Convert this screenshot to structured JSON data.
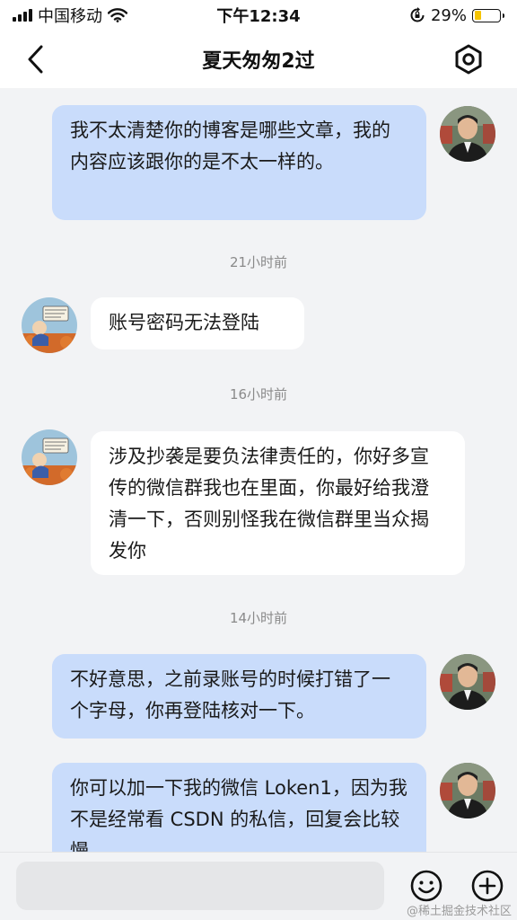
{
  "status_bar": {
    "carrier": "中国移动",
    "time": "下午12:34",
    "battery_percent": "29%",
    "battery_level": 0.29,
    "battery_color": "#f5c400"
  },
  "nav": {
    "title": "夏天匆匆2过",
    "back_icon": "chevron-left-icon",
    "settings_icon": "hexagon-settings-icon"
  },
  "messages": [
    {
      "side": "out",
      "text": "我不太清楚你的博客是哪些文章，我的内容应该跟你的是不太一样的。"
    },
    {
      "timestamp": "21小时前"
    },
    {
      "side": "in",
      "text": "账号密码无法登陆"
    },
    {
      "timestamp": "16小时前"
    },
    {
      "side": "in",
      "text": "涉及抄袭是要负法律责任的，你好多宣传的微信群我也在里面，你最好给我澄清一下，否则别怪我在微信群里当众揭发你"
    },
    {
      "timestamp": "14小时前"
    },
    {
      "side": "out",
      "text": "不好意思，之前录账号的时候打错了一个字母，你再登陆核对一下。"
    },
    {
      "side": "out",
      "text": "你可以加一下我的微信 Loken1，因为我不是经常看 CSDN 的私信，回复会比较慢"
    }
  ],
  "input_bar": {
    "placeholder": "",
    "emoji_icon": "smiley-icon",
    "plus_icon": "plus-circle-icon"
  },
  "watermark": "@稀土掘金技术社区",
  "colors": {
    "outgoing_bubble": "#c9dcfb",
    "incoming_bubble": "#ffffff",
    "background": "#f2f3f5"
  }
}
